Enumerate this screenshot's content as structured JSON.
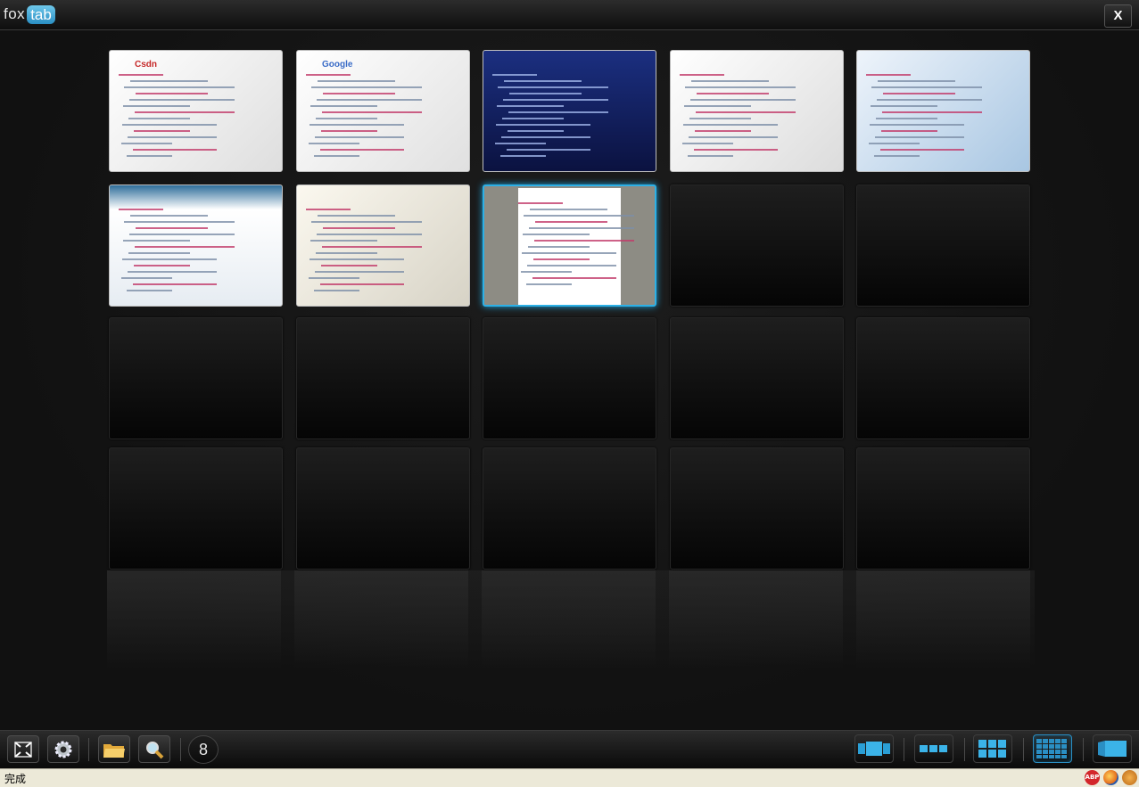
{
  "app": {
    "logo_left": "fox",
    "logo_right": "tab",
    "close_label": "X"
  },
  "tiles": [
    {
      "row": 0,
      "col": 0,
      "state": "thumbnail",
      "site": "Csdn"
    },
    {
      "row": 0,
      "col": 1,
      "state": "thumbnail",
      "site": "Google"
    },
    {
      "row": 0,
      "col": 2,
      "state": "thumbnail",
      "site": ""
    },
    {
      "row": 0,
      "col": 3,
      "state": "thumbnail",
      "site": ""
    },
    {
      "row": 0,
      "col": 4,
      "state": "thumbnail",
      "site": ""
    },
    {
      "row": 1,
      "col": 0,
      "state": "thumbnail",
      "site": ""
    },
    {
      "row": 1,
      "col": 1,
      "state": "thumbnail",
      "site": ""
    },
    {
      "row": 1,
      "col": 2,
      "state": "selected",
      "site": ""
    },
    {
      "row": 1,
      "col": 3,
      "state": "empty"
    },
    {
      "row": 1,
      "col": 4,
      "state": "empty"
    },
    {
      "row": 2,
      "col": 0,
      "state": "empty"
    },
    {
      "row": 2,
      "col": 1,
      "state": "empty"
    },
    {
      "row": 2,
      "col": 2,
      "state": "empty"
    },
    {
      "row": 2,
      "col": 3,
      "state": "empty"
    },
    {
      "row": 2,
      "col": 4,
      "state": "empty"
    },
    {
      "row": 3,
      "col": 0,
      "state": "empty"
    },
    {
      "row": 3,
      "col": 1,
      "state": "empty"
    },
    {
      "row": 3,
      "col": 2,
      "state": "empty"
    },
    {
      "row": 3,
      "col": 3,
      "state": "empty"
    },
    {
      "row": 3,
      "col": 4,
      "state": "empty"
    }
  ],
  "toolbar": {
    "left_buttons": [
      "fullscreen-icon",
      "gear-icon",
      "folder-icon",
      "search-icon"
    ],
    "tab_count": "8",
    "view_buttons": [
      "carousel-view-icon",
      "row-view-icon",
      "small-grid-view-icon",
      "large-grid-view-icon",
      "wall-view-icon"
    ],
    "active_view": "large-grid-view-icon"
  },
  "status": {
    "text": "完成",
    "icons": [
      "adblock-icon",
      "firefox-icon",
      "firebug-icon"
    ]
  },
  "colors": {
    "accent": "#2cb0e6",
    "background": "#131313",
    "status_bg": "#ece9d8"
  }
}
